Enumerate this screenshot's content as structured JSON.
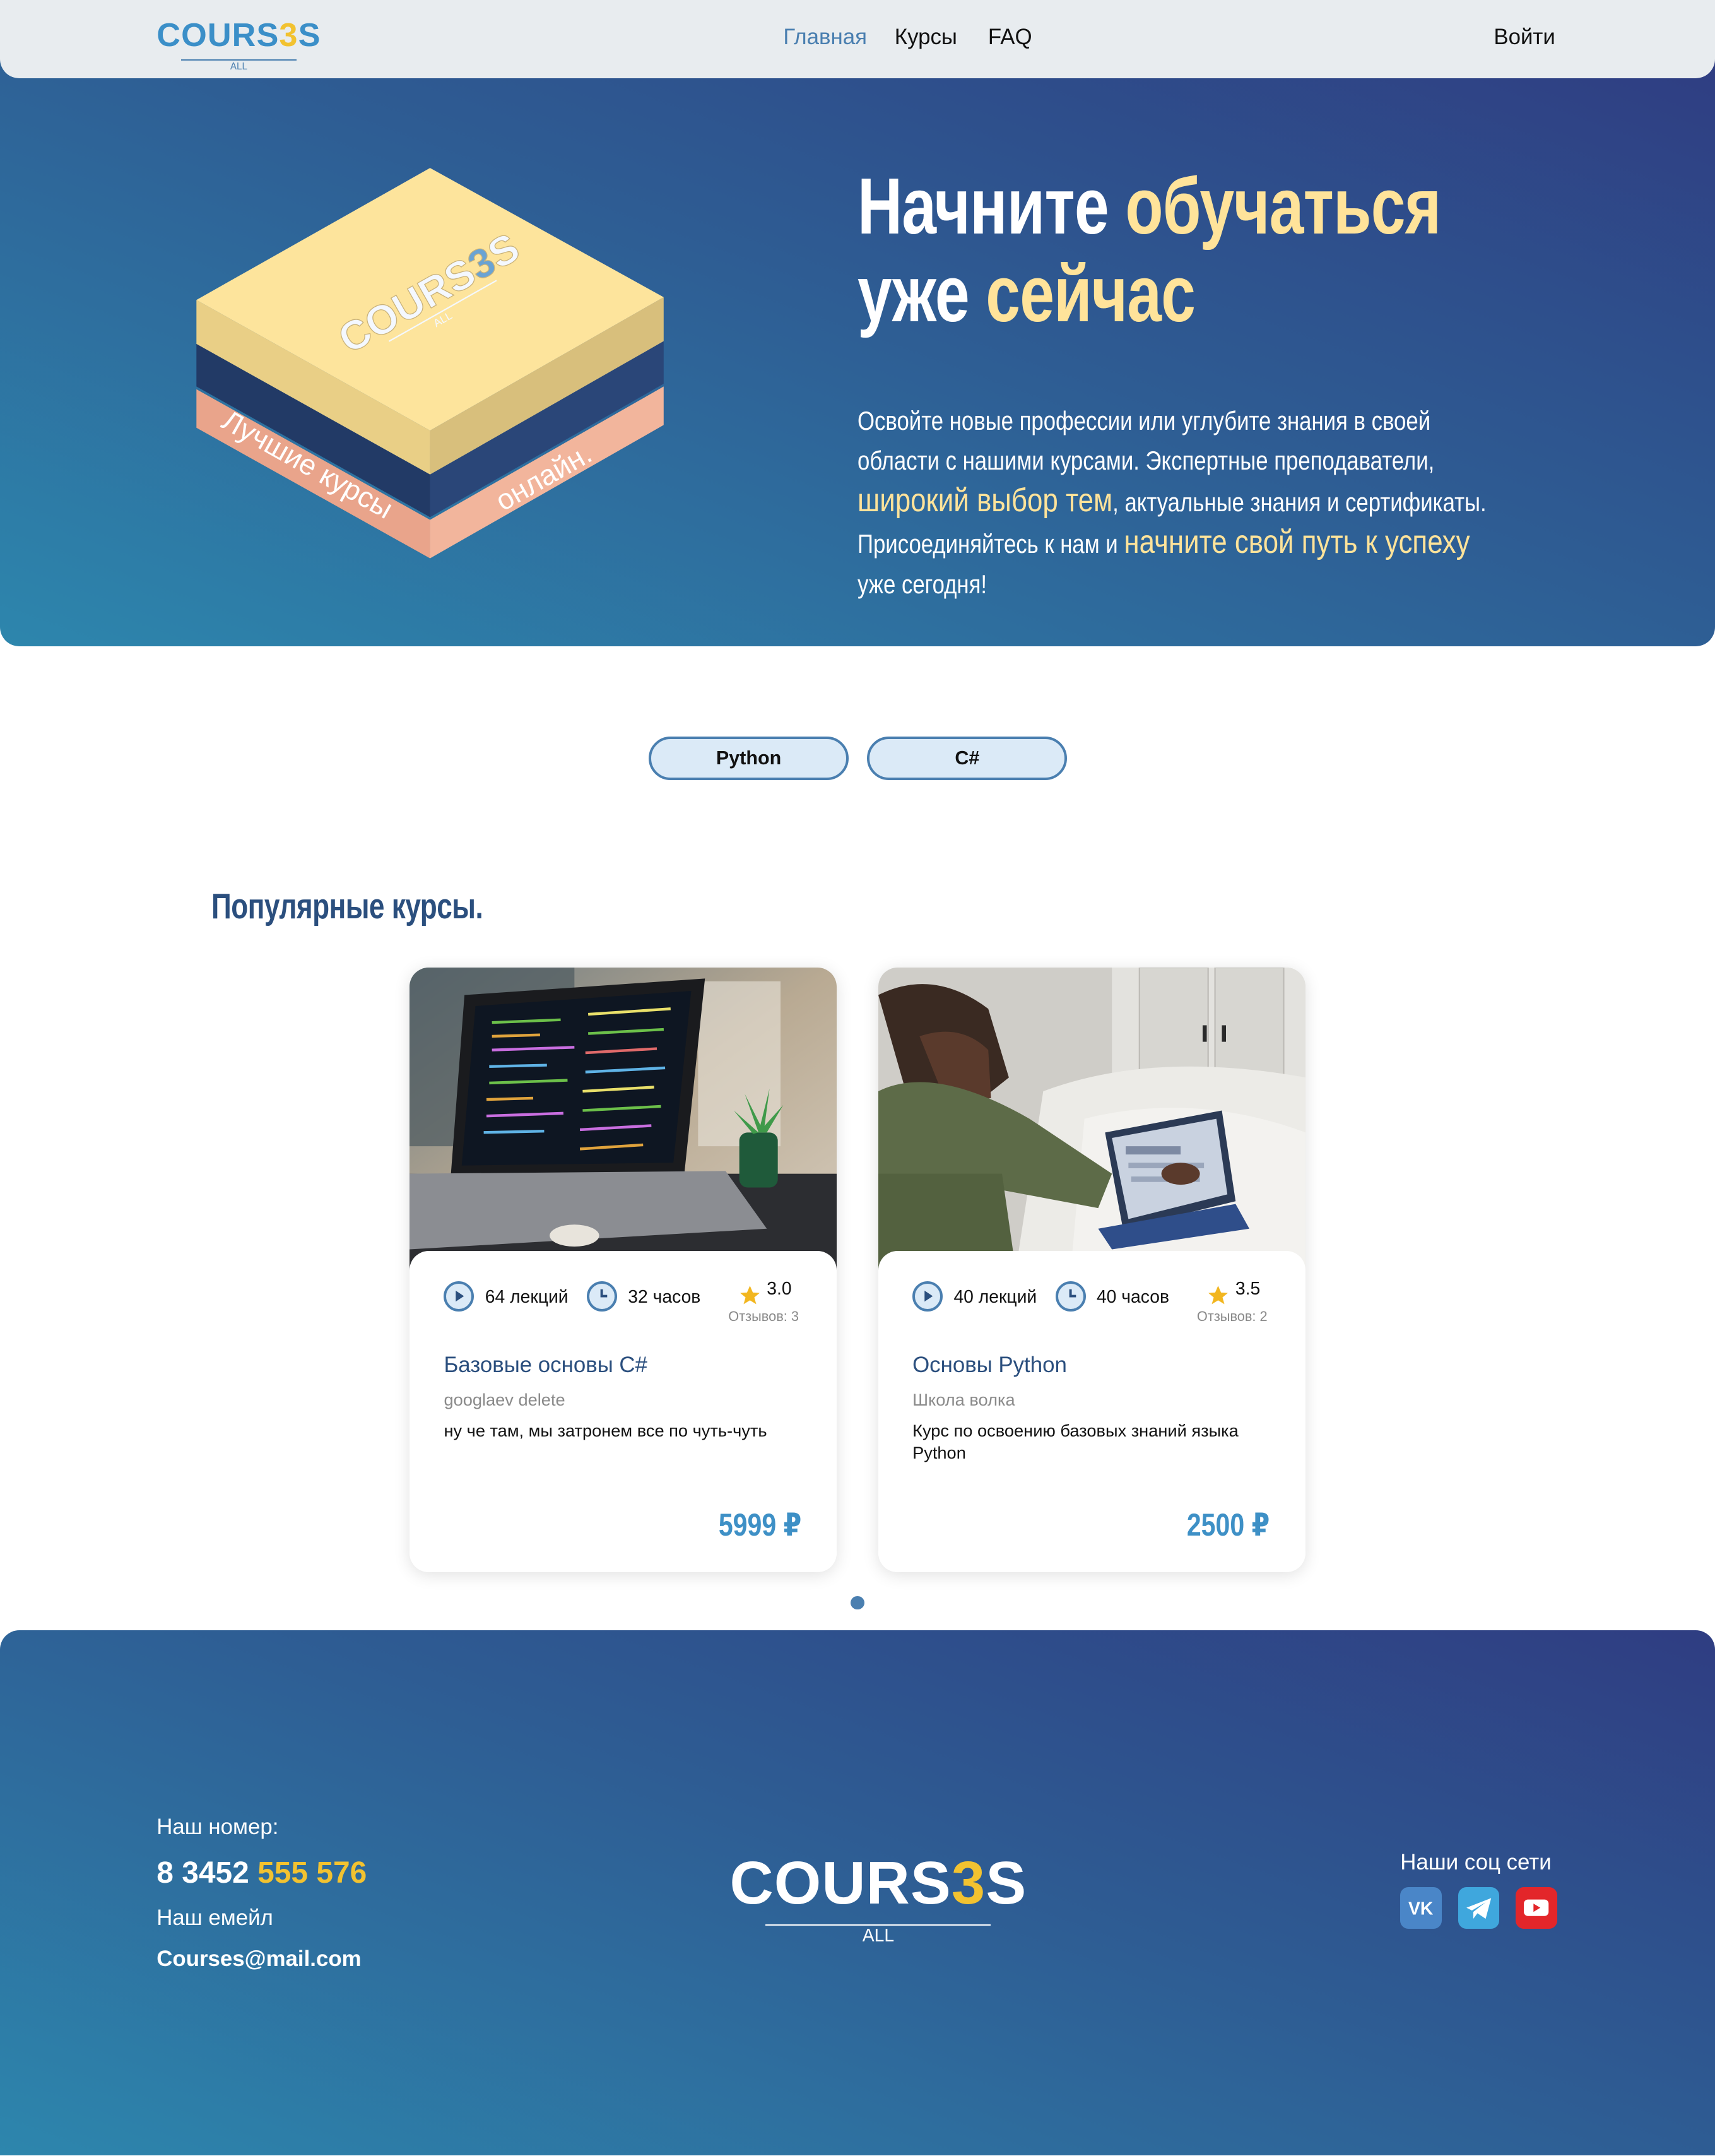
{
  "header": {
    "logo": {
      "text_a": "COURS",
      "text_b": "3",
      "text_c": "S",
      "sub": "ALL"
    },
    "nav": [
      {
        "label": "Главная"
      },
      {
        "label": "Курсы"
      },
      {
        "label": "FAQ"
      }
    ],
    "login_label": "Войти"
  },
  "hero": {
    "illustration": {
      "logo": {
        "text_a": "COURS",
        "text_b": "3",
        "text_c": "S",
        "sub": "ALL"
      },
      "side_left": "Лучшие курсы",
      "side_right": "онлайн."
    },
    "title": {
      "line1_a": "Начните ",
      "line1_b": "обучаться",
      "line2_a": "уже ",
      "line2_b": "сейчас"
    },
    "text": {
      "p1": "Освойте новые профессии или углубите знания в своей области с нашими курсами. Экспертные преподаватели, ",
      "h1": "широкий выбор тем",
      "p2": ", актуальные знания и сертификаты. Присоединяйтесь к нам и ",
      "h2": "начните свой путь к успеху",
      "p3": " уже сегодня!"
    }
  },
  "filters": [
    {
      "label": "Python"
    },
    {
      "label": "C#"
    }
  ],
  "popular": {
    "title": "Популярные курсы.",
    "courses": [
      {
        "lectures": "64 лекций",
        "hours": "32 часов",
        "rating": "3.0",
        "reviews": "Отзывов: 3",
        "title": "Базовые основы C#",
        "author": "googlaev delete",
        "description": "ну че там, мы затронем все по чуть-чуть",
        "price": "5999 ₽",
        "image": "laptop-with-code-photo"
      },
      {
        "lectures": "40 лекций",
        "hours": "40 часов",
        "rating": "3.5",
        "reviews": "Отзывов: 2",
        "title": "Основы Python",
        "author": "Школа волка",
        "description": "Курс по освоению базовых знаний языка Python",
        "price": "2500 ₽",
        "image": "woman-with-tablet-photo"
      }
    ]
  },
  "footer": {
    "phone_label": "Наш номер:",
    "phone_a": "8 3452 ",
    "phone_b": "555 576",
    "email_label": "Наш емейл",
    "email": "Courses@mail.com",
    "logo": {
      "text_a": "COURS",
      "text_b": "3",
      "text_c": "S",
      "sub": "ALL"
    },
    "social_label": "Наши соц сети",
    "socials": [
      {
        "icon": "vk-icon",
        "color": "#4a86c8"
      },
      {
        "icon": "telegram-icon",
        "color": "#3fa7dd"
      },
      {
        "icon": "youtube-icon",
        "color": "#e3262a"
      }
    ]
  },
  "colors": {
    "accent": "#4a7fb0",
    "yellow": "#f2c230",
    "hero_yellow": "#ffe39a",
    "dark_blue": "#2b4f7e"
  }
}
